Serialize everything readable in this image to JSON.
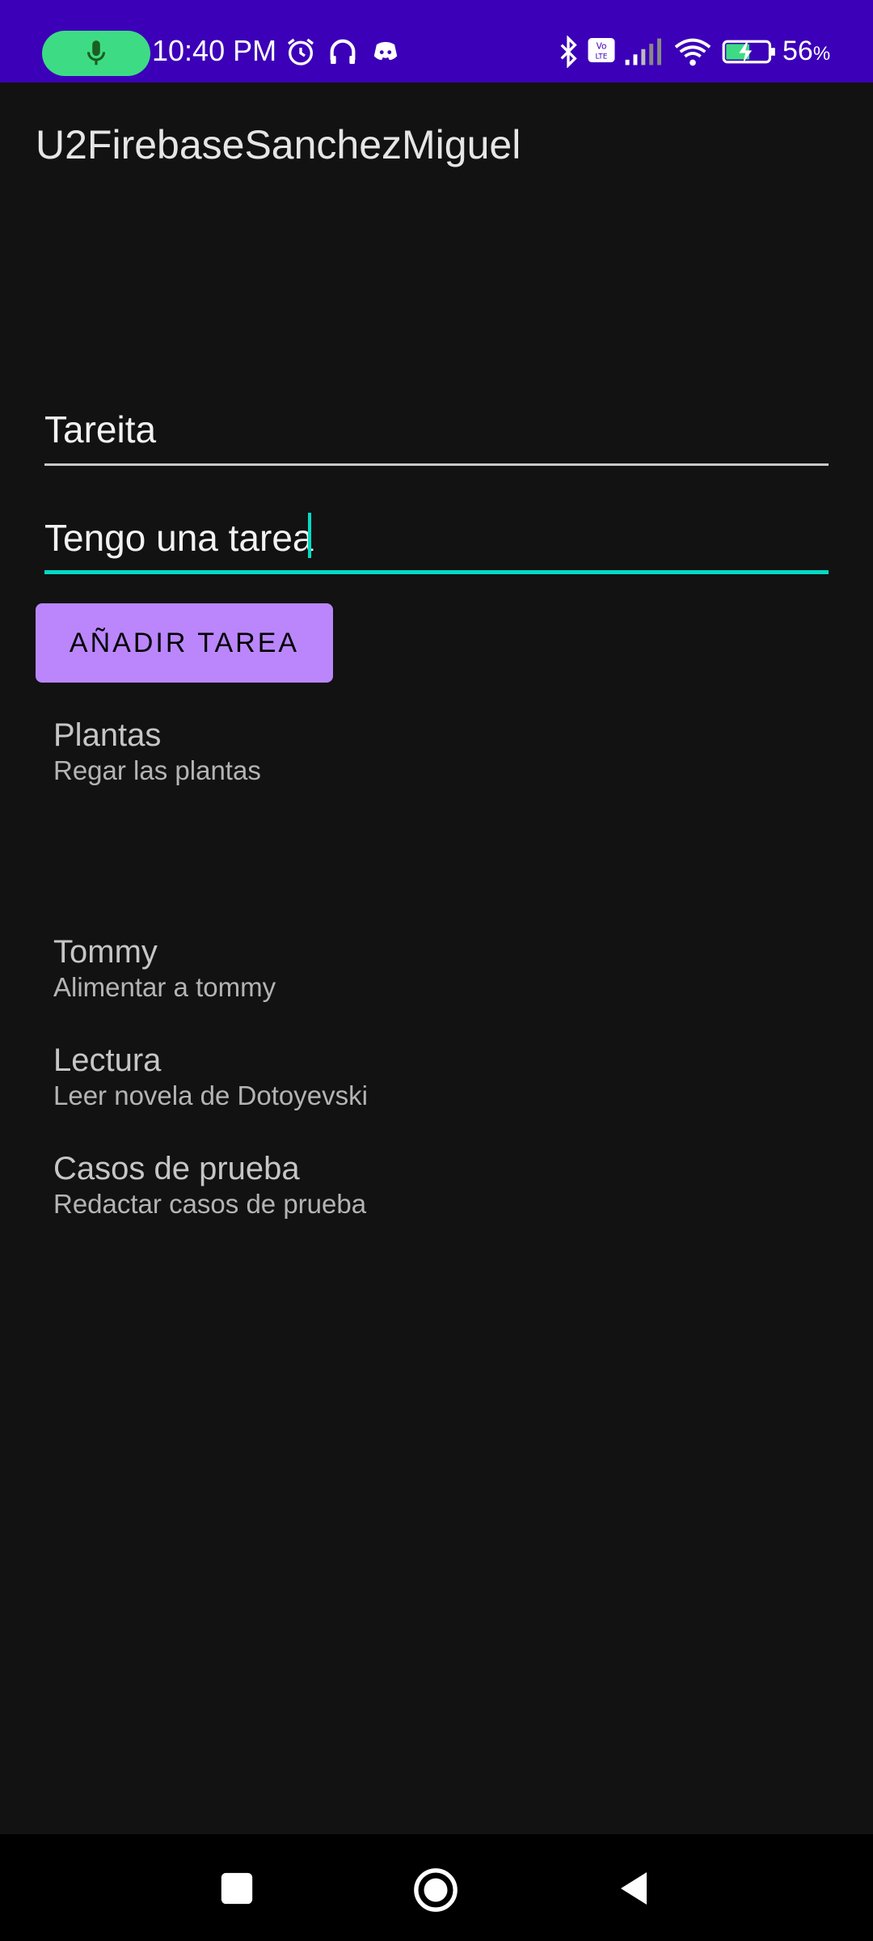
{
  "status_bar": {
    "time": "10:40 PM",
    "battery_percent": "56",
    "battery_unit": "%",
    "icons": [
      "mic-icon",
      "alarm-icon",
      "headphones-icon",
      "discord-icon",
      "bluetooth-icon",
      "volte-icon",
      "signal-icon",
      "wifi-icon",
      "battery-charging-icon"
    ],
    "background_color": "#3c00b8"
  },
  "app": {
    "title": "U2FirebaseSanchezMiguel"
  },
  "form": {
    "title_value": "Tareita",
    "description_value": "Tengo una tarea",
    "add_button_label": "AÑADIR TAREA",
    "accent_color": "#03dac5",
    "button_color": "#bb86fc"
  },
  "tasks": [
    {
      "title": "Plantas",
      "description": "Regar las plantas"
    },
    {
      "title": "Tommy",
      "description": "Alimentar a tommy"
    },
    {
      "title": "Lectura",
      "description": "Leer novela de Dotoyevski"
    },
    {
      "title": "Casos de prueba",
      "description": "Redactar casos de prueba"
    }
  ],
  "nav_bar": {
    "icons": [
      "recents-square-icon",
      "home-circle-icon",
      "back-triangle-icon"
    ]
  }
}
